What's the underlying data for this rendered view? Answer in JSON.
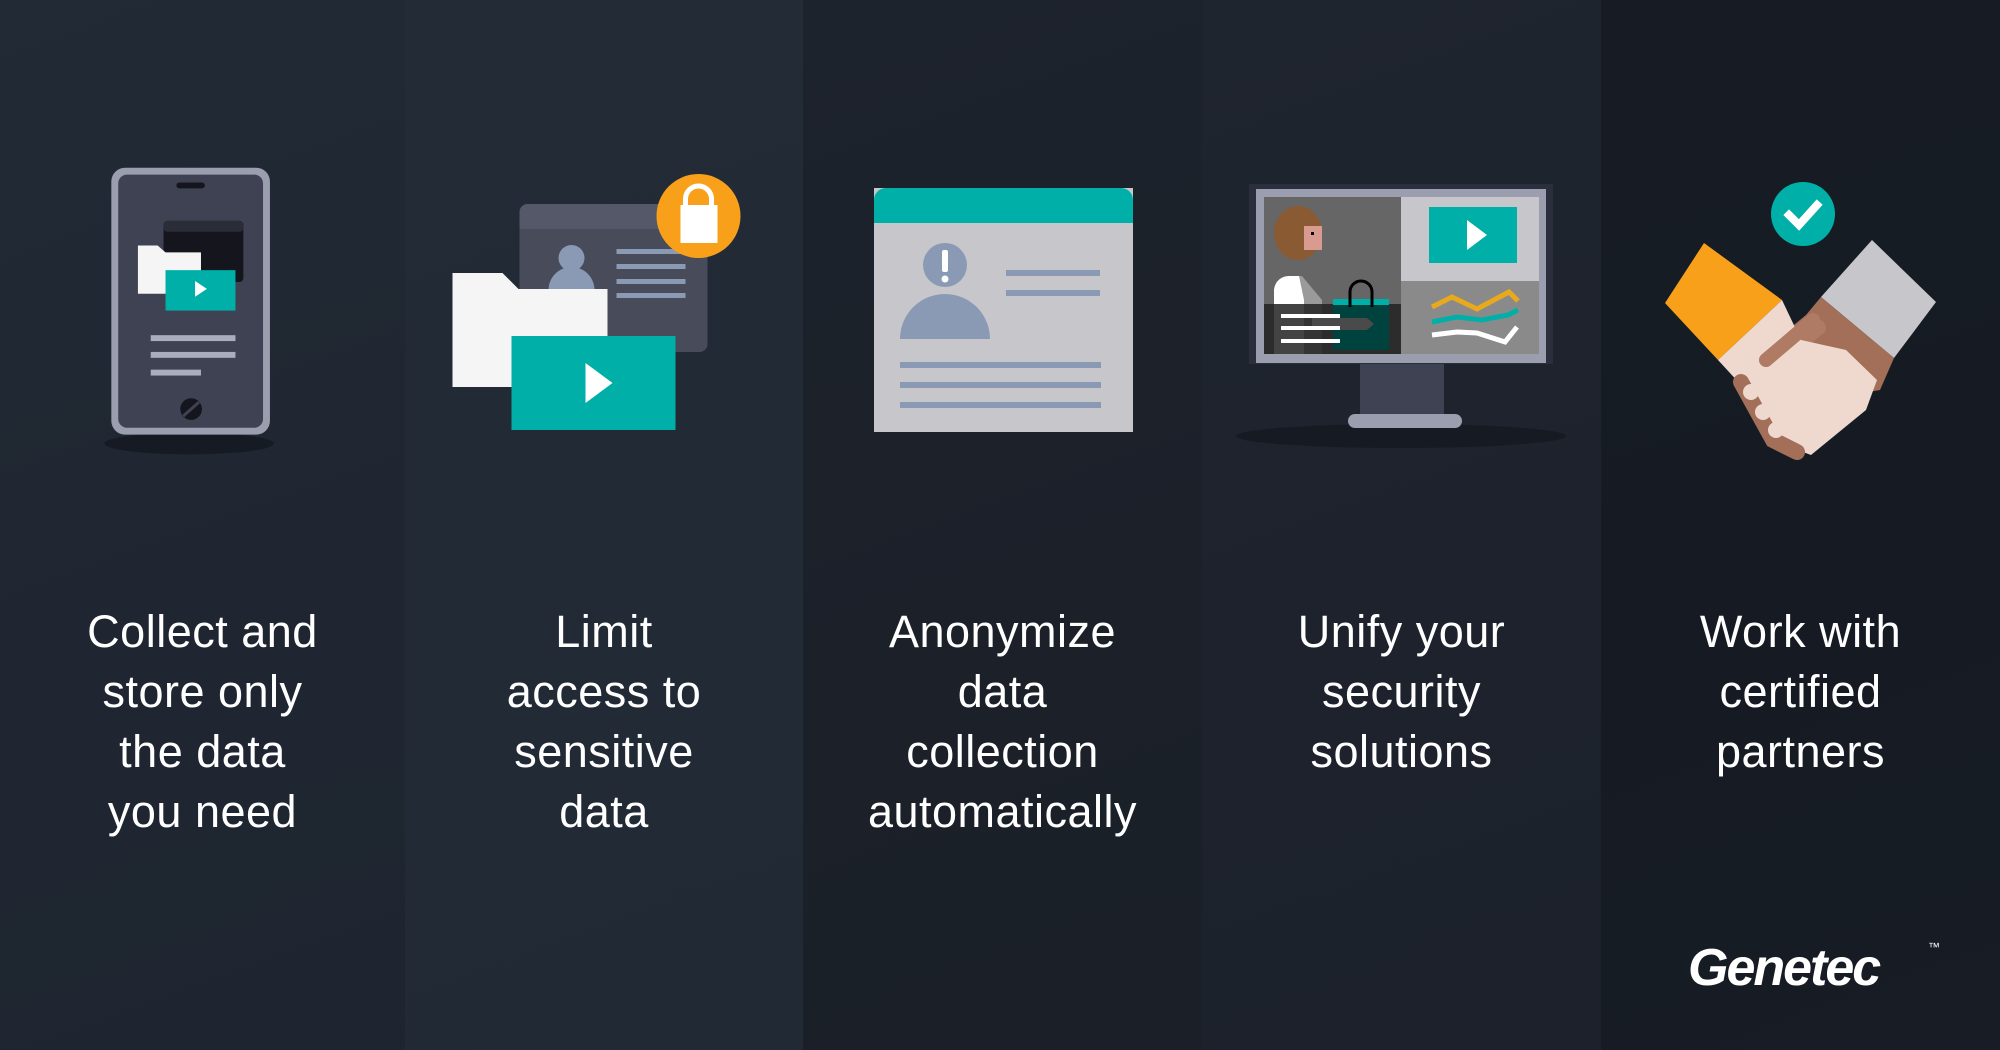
{
  "colors": {
    "teal": "#00b0a8",
    "orange": "#f9a01b",
    "slate": "#8999b3",
    "text": "#ffffff"
  },
  "columns": [
    {
      "icon": "smartphone-media-icon",
      "caption_lines": [
        "Collect and",
        "store only",
        "the data",
        "you need"
      ]
    },
    {
      "icon": "locked-files-icon",
      "caption_lines": [
        "Limit",
        "access to",
        "sensitive",
        "data"
      ]
    },
    {
      "icon": "anonymized-profile-icon",
      "caption_lines": [
        "Anonymize",
        "data",
        "collection",
        "automatically"
      ]
    },
    {
      "icon": "security-monitor-icon",
      "caption_lines": [
        "Unify your",
        "security",
        "solutions"
      ]
    },
    {
      "icon": "handshake-check-icon",
      "caption_lines": [
        "Work with",
        "certified",
        "partners"
      ]
    }
  ],
  "brand": {
    "logo_text": "Genetec",
    "trademark": "™"
  }
}
